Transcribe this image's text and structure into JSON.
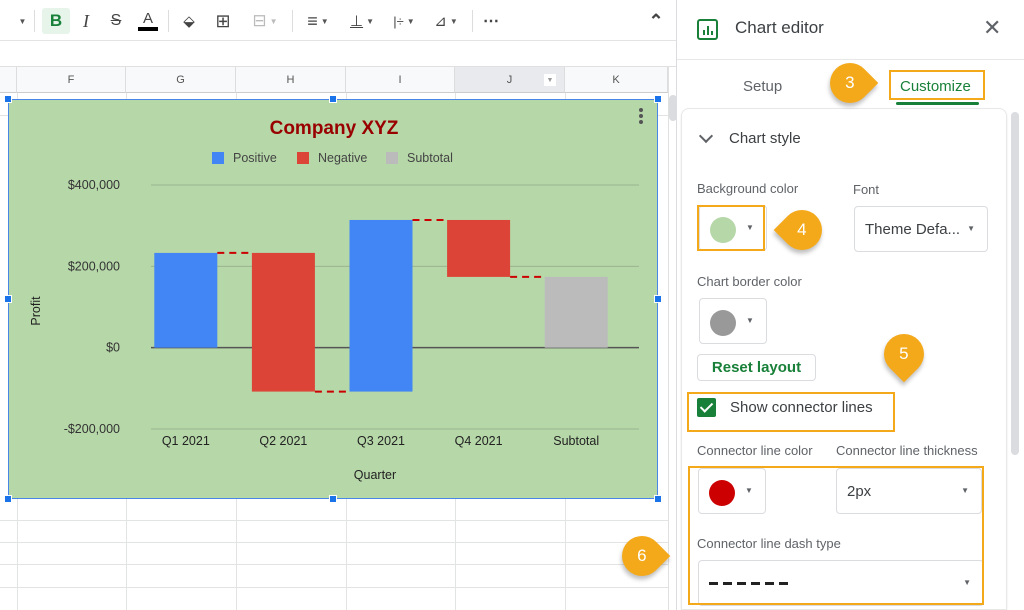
{
  "toolbar": {
    "items": [
      {
        "icon": "more-formats-caret-icon"
      },
      {
        "label": "B",
        "icon": "bold-icon"
      },
      {
        "label": "I",
        "icon": "italic-icon"
      },
      {
        "label": "S",
        "icon": "strikethrough-icon"
      },
      {
        "label": "A",
        "icon": "text-color-icon"
      },
      {
        "label": "⬙",
        "icon": "fill-color-icon"
      },
      {
        "label": "⊞",
        "icon": "borders-icon"
      },
      {
        "label": "⊟",
        "icon": "merge-cells-icon"
      },
      {
        "label": "≡",
        "icon": "horizontal-align-icon"
      },
      {
        "label": "⊥",
        "icon": "vertical-align-icon"
      },
      {
        "label": "|÷",
        "icon": "text-wrapping-icon"
      },
      {
        "label": "⊿",
        "icon": "text-rotation-icon"
      },
      {
        "label": "⋯",
        "icon": "more-icon"
      },
      {
        "label": "⌃",
        "icon": "collapse-menu-icon"
      }
    ]
  },
  "sheet": {
    "columns": [
      "F",
      "G",
      "H",
      "I",
      "J",
      "K"
    ],
    "selected_column": "J"
  },
  "chart_data": {
    "type": "waterfall",
    "title": "Company XYZ",
    "xlabel": "Quarter",
    "ylabel": "Profit",
    "categories": [
      "Q1 2021",
      "Q2 2021",
      "Q3 2021",
      "Q4 2021",
      "Subtotal"
    ],
    "values": [
      233000,
      -341000,
      422000,
      -140000,
      174000
    ],
    "kinds": [
      "positive",
      "negative",
      "positive",
      "negative",
      "subtotal"
    ],
    "legend": [
      {
        "name": "Positive",
        "color": "#4285f4"
      },
      {
        "name": "Negative",
        "color": "#db4437"
      },
      {
        "name": "Subtotal",
        "color": "#bbbbbb"
      }
    ],
    "legend_position": "top",
    "yticks": [
      400000,
      200000,
      0,
      -200000
    ],
    "ytick_labels": [
      "$400,000",
      "$200,000",
      "$0",
      "-$200,000"
    ],
    "ylim": [
      -200000,
      400000
    ],
    "grid": true,
    "background_color": "#b6d7a8",
    "title_color": "#990000",
    "connector_lines": {
      "show": true,
      "color": "#cc0000",
      "thickness": "2px",
      "dash": "dashed"
    }
  },
  "editor": {
    "title": "Chart editor",
    "tabs": [
      {
        "label": "Setup"
      },
      {
        "label": "Customize",
        "active": true
      }
    ],
    "section": "Chart style",
    "background_color_label": "Background color",
    "background_color": "#b6d7a8",
    "font_label": "Font",
    "font_value": "Theme Defa...",
    "border_color_label": "Chart border color",
    "border_color": "#999999",
    "reset_label": "Reset layout",
    "show_connector_label": "Show connector lines",
    "show_connector_checked": true,
    "connector_color_label": "Connector line color",
    "connector_color": "#cc0000",
    "connector_thickness_label": "Connector line thickness",
    "connector_thickness_value": "2px",
    "connector_dash_label": "Connector line dash type",
    "connector_dash_value": "dashed"
  },
  "callouts": [
    {
      "number": "3"
    },
    {
      "number": "4"
    },
    {
      "number": "5"
    },
    {
      "number": "6"
    }
  ]
}
